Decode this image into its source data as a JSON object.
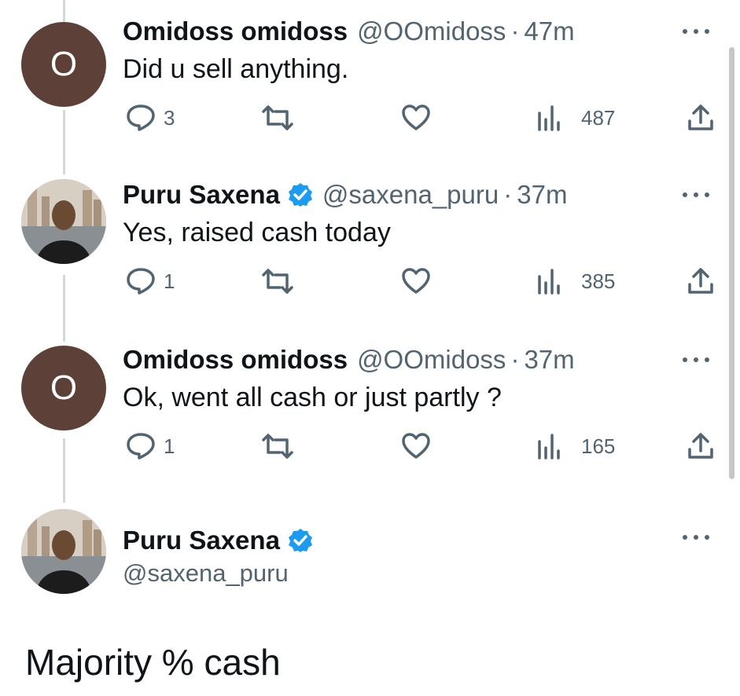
{
  "tweets": [
    {
      "avatar_letter": "O",
      "avatar_color": "#5d4037",
      "name": "Omidoss omidoss",
      "handle": "@OOmidoss",
      "dot": "·",
      "time": "47m",
      "text": "Did u sell anything.",
      "replies": "3",
      "views": "487"
    },
    {
      "name": "Puru Saxena",
      "handle": "@saxena_puru",
      "dot": "·",
      "time": "37m",
      "text": "Yes, raised cash today",
      "replies": "1",
      "views": "385"
    },
    {
      "avatar_letter": "O",
      "avatar_color": "#5d4037",
      "name": "Omidoss omidoss",
      "handle": "@OOmidoss",
      "dot": "·",
      "time": "37m",
      "text": "Ok, went all cash or just partly ?",
      "replies": "1",
      "views": "165"
    }
  ],
  "main": {
    "name": "Puru Saxena",
    "handle": "@saxena_puru",
    "text": "Majority % cash"
  },
  "colors": {
    "verified": "#1d9bf0",
    "secondary_text": "#536471",
    "thread_line": "#cfd9de"
  }
}
